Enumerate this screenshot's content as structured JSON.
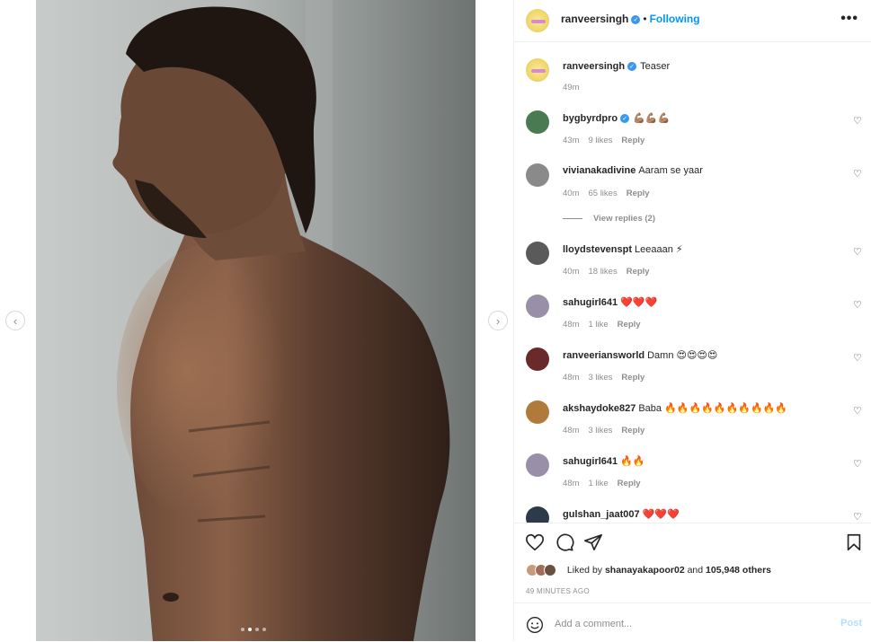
{
  "post": {
    "author": "ranveersingh",
    "follow_status": "Following",
    "separator": "•",
    "more_glyph": "•••",
    "verified_glyph": "✓",
    "caption": {
      "username": "ranveersingh",
      "text": "Teaser",
      "time": "49m"
    },
    "media": {
      "prev_glyph": "‹",
      "next_glyph": "›",
      "carousel_count": 4,
      "carousel_active_index": 1
    }
  },
  "comments": [
    {
      "username": "bygbyrdpro",
      "verified": true,
      "text": "💪🏽💪🏽💪🏽",
      "time": "43m",
      "likes": "9 likes",
      "reply": "Reply",
      "avatar_color": "#4a7a52"
    },
    {
      "username": "vivianakadivine",
      "verified": false,
      "text": "Aaram se yaar",
      "time": "40m",
      "likes": "65 likes",
      "reply": "Reply",
      "avatar_color": "#8a8a8a",
      "view_replies": "View replies (2)"
    },
    {
      "username": "lloydstevenspt",
      "verified": false,
      "text": "Leeaaan ⚡",
      "time": "40m",
      "likes": "18 likes",
      "reply": "Reply",
      "avatar_color": "#5a5a5a"
    },
    {
      "username": "sahugirl641",
      "verified": false,
      "text": "❤️❤️❤️",
      "time": "48m",
      "likes": "1 like",
      "reply": "Reply",
      "avatar_color": "#9a8fa8"
    },
    {
      "username": "ranveeriansworld",
      "verified": false,
      "text": "Damn 😍😍😍😍",
      "time": "48m",
      "likes": "3 likes",
      "reply": "Reply",
      "avatar_color": "#6b2a2a"
    },
    {
      "username": "akshaydoke827",
      "verified": false,
      "text": "Baba 🔥🔥🔥🔥🔥🔥🔥🔥🔥🔥",
      "time": "48m",
      "likes": "3 likes",
      "reply": "Reply",
      "avatar_color": "#b07a3a"
    },
    {
      "username": "sahugirl641",
      "verified": false,
      "text": "🔥🔥",
      "time": "48m",
      "likes": "1 like",
      "reply": "Reply",
      "avatar_color": "#9a8fa8"
    },
    {
      "username": "gulshan_jaat007",
      "verified": false,
      "text": "❤️❤️❤️",
      "time": "",
      "likes": "",
      "reply": "",
      "avatar_color": "#2d3a4a"
    }
  ],
  "actions": {
    "liked_by_prefix": "Liked by",
    "liked_by_user": "shanayakapoor02",
    "liked_by_and": "and",
    "liked_by_others": "105,948 others",
    "time_ago": "49 MINUTES AGO"
  },
  "composer": {
    "placeholder": "Add a comment...",
    "post_label": "Post"
  },
  "colors": {
    "accent": "#0095f6",
    "verified": "#3897f0",
    "muted": "#8e8e8e",
    "post_disabled": "#b2dffc"
  }
}
